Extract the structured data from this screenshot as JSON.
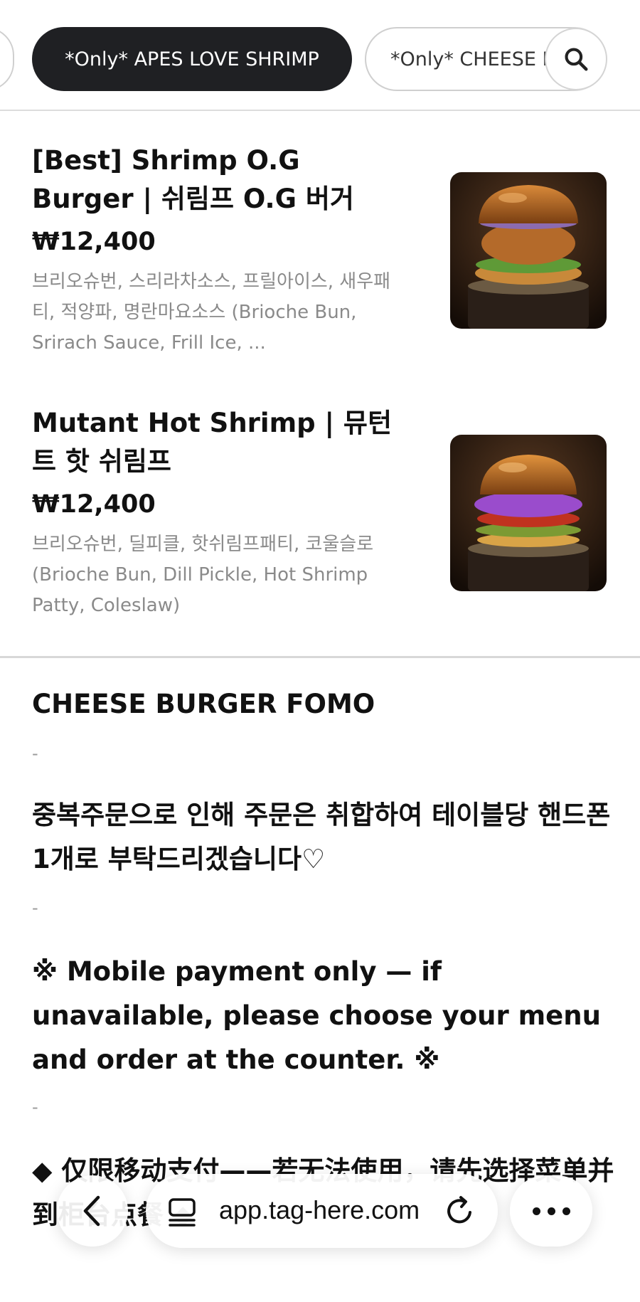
{
  "category_chips": {
    "active_label": "*Only* APES LOVE SHRIMP",
    "next_label": "*Only* CHEESE BURGER FOMO"
  },
  "menu_items": [
    {
      "name": "[Best] Shrimp O.G Burger | 쉬림프 O.G 버거",
      "price": "₩12,400",
      "description": "브리오슈번, 스리라차소스, 프릴아이스, 새우패티, 적양파, 명란마요소스 (Brioche Bun, Srirach Sauce, Frill Ice, ..."
    },
    {
      "name": "Mutant Hot Shrimp | 뮤턴트 핫 쉬림프",
      "price": "₩12,400",
      "description": "브리오슈번, 딜피클, 핫쉬림프패티, 코울슬로 (Brioche Bun, Dill Pickle, Hot Shrimp Patty, Coleslaw)"
    }
  ],
  "section": {
    "title": "CHEESE BURGER FOMO",
    "dash": "-",
    "notice_ko": "중복주문으로 인해 주문은 취합하여 테이블당 핸드폰 1개로 부탁드리겠습니다♡",
    "notice_en": "※ Mobile payment only — if unavailable, please choose your menu and order at the counter. ※",
    "notice_zh": "◆ 仅限移动支付——若无法使用，请先选择菜单并到柜台点餐 ◆"
  },
  "browser": {
    "url": "app.tag-here.com",
    "icons": [
      "back-chevron-icon",
      "tabs-icon",
      "reload-icon",
      "more-dots-icon",
      "search-icon"
    ]
  },
  "colors": {
    "chip_active_bg": "#1f2023",
    "price_text": "#111111",
    "desc_text": "#8a8a8a"
  }
}
